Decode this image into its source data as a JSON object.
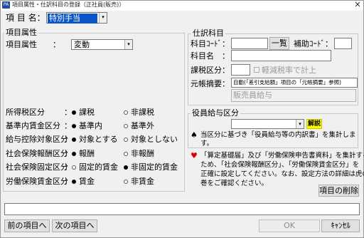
{
  "window": {
    "title": "項目属性・仕訳科目の登録（正社員(販売)）",
    "icon_text": "PA",
    "close_glyph": "✕"
  },
  "item_name": {
    "label": "項 目 名：",
    "value": "特別手当",
    "dropdown_glyph": "▾"
  },
  "attributes_group": {
    "title": "項目属性",
    "attr_label": "項目属性　　：",
    "attr_value": "変動",
    "dropdown_glyph": "▾"
  },
  "radio_rows": [
    {
      "label": "所得税区分",
      "colon": "：",
      "opt1": "課税",
      "opt2": "非課税",
      "selected": 1
    },
    {
      "label": "基準内賃金区分",
      "colon": "：",
      "opt1": "基準内",
      "opt2": "基準外",
      "selected": 1
    },
    {
      "label": "給与控除対象区分",
      "colon": "：",
      "opt1": "対象とする",
      "opt2": "対象としない",
      "selected": 1
    },
    {
      "label": "社会保険報酬区分",
      "colon": "：",
      "opt1": "報酬",
      "opt2": "非報酬",
      "selected": 1
    },
    {
      "label": "社会保険固定区分",
      "colon": "：",
      "opt1": "固定的賃金",
      "opt2": "非固定的賃金",
      "selected": 2
    },
    {
      "label": "労働保険賃金区分",
      "colon": "：",
      "opt1": "賃金",
      "opt2": "非賃金",
      "selected": 1
    }
  ],
  "journal_group": {
    "title": "仕訳科目",
    "account_code_label": "科目ｺｰﾄﾞ：",
    "account_code_value": "",
    "list_button": "一覧",
    "aux_code_label": "補助ｺｰﾄﾞ：",
    "aux_code_value": "",
    "account_name_label": "科目名　：",
    "account_name_value": "",
    "tax_class_label": "課税区分：",
    "tax_class_value": "",
    "reduced_rate_label": "軽減税率で計上",
    "ledger_summary_label": "元帳摘要：",
    "ledger_summary_value": "自動(「差引支給額」項目の「元帳摘要」参照)",
    "ledger_text_value": "販売員給与"
  },
  "officer_group": {
    "title": "役員給与区分",
    "select_value": "",
    "dropdown_glyph": "▾",
    "explain_button": "解説",
    "spade_glyph": "♠",
    "note_line1": "当区分に基づき「役員給与等の内訳書」を集計しま",
    "note_line2": "す。"
  },
  "heart_note": {
    "glyph": "♥",
    "lines": [
      "「算定基礎届」及び「労働保険申告書資料」を集計する",
      "ため、「社会保険報酬区分」、「労働保険賃金区分」を",
      "正確に設定してください。なお、設定方法の詳細は虎の",
      "巻をご確認ください。"
    ]
  },
  "delete_item_button": "項目の削除",
  "bottom_input": "",
  "nav": {
    "prev_button": "前の項目へ",
    "next_button": "次の項目へ",
    "ok_button": "OK",
    "cancel_button": "ｷｬﾝｾﾙ"
  },
  "colors": {
    "selection": "#0a55c8",
    "explain_bg": "#ffff00",
    "heart": "#e00000",
    "disabled_text": "#9a9a9a"
  }
}
